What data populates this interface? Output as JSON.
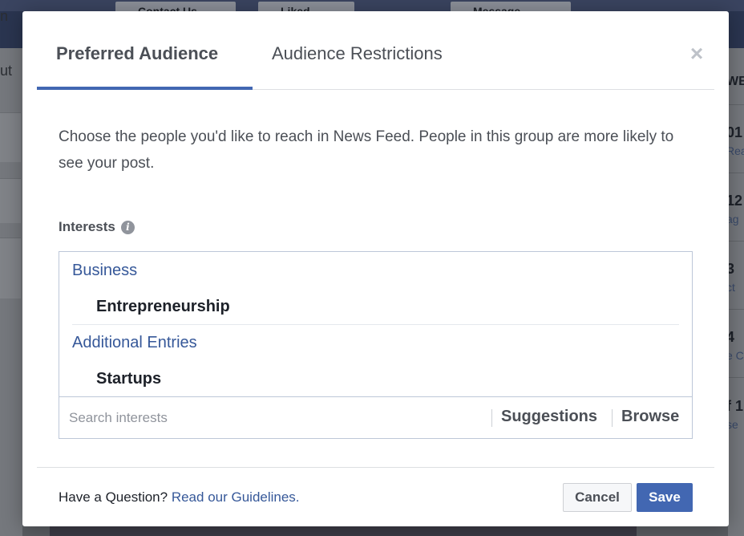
{
  "background": {
    "top_buttons": [
      "Contact Us",
      "Liked",
      "Message"
    ],
    "left_fragments": [
      "n",
      "ut"
    ],
    "right_fragments": {
      "header": "WE",
      "items": [
        {
          "value": "01",
          "sub": "Rea"
        },
        {
          "value": "12",
          "sub": "ag"
        },
        {
          "value": "3",
          "sub": "ct"
        },
        {
          "value": "4",
          "sub": "e C"
        },
        {
          "value": "f 1",
          "sub": "se"
        }
      ]
    }
  },
  "dialog": {
    "tabs": [
      {
        "label": "Preferred Audience",
        "active": true
      },
      {
        "label": "Audience Restrictions",
        "active": false
      }
    ],
    "close_glyph": "×",
    "intro_text": "Choose the people you'd like to reach in News Feed. People in this group are more likely to see your post.",
    "interests_label": "Interests",
    "info_glyph": "i",
    "interest_groups": [
      {
        "category": "Business",
        "items": [
          "Entrepreneurship"
        ]
      },
      {
        "category": "Additional Entries",
        "items": [
          "Startups"
        ]
      }
    ],
    "search": {
      "placeholder": "Search interests",
      "value": "",
      "suggestions_label": "Suggestions",
      "browse_label": "Browse"
    },
    "footer": {
      "question": "Have a Question?",
      "link_text": "Read our Guidelines."
    },
    "buttons": {
      "cancel": "Cancel",
      "save": "Save"
    }
  },
  "colors": {
    "accent": "#4267b2",
    "link": "#365899",
    "text": "#1d2129",
    "muted_text": "#4b4f56",
    "border": "#bdc7d8"
  }
}
